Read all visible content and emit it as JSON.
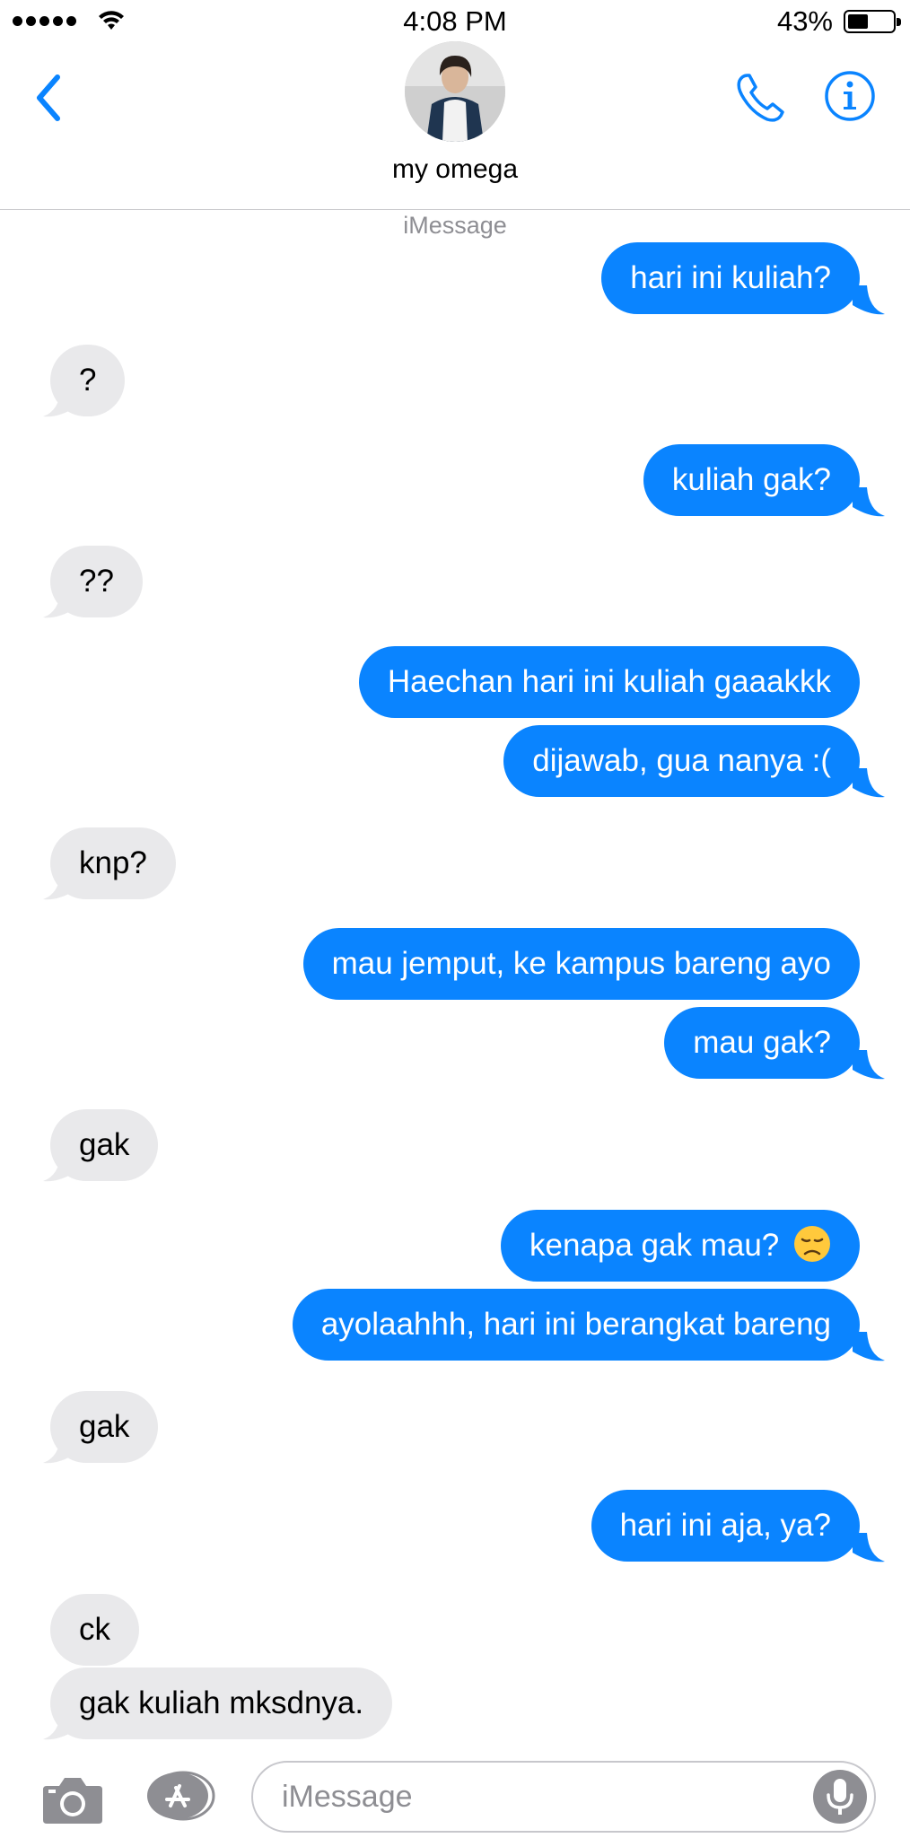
{
  "status_bar": {
    "time": "4:08 PM",
    "battery_percent": "43%",
    "battery_level": 0.43,
    "signal_bars": 5
  },
  "header": {
    "contact_name": "my omega",
    "service_label": "iMessage"
  },
  "colors": {
    "accent": "#0a84ff",
    "incoming_bubble": "#e9e9eb",
    "secondary_text": "#8e8e93"
  },
  "messages": [
    {
      "direction": "outgoing",
      "text": "hari ini kuliah?"
    },
    {
      "direction": "incoming",
      "text": "?"
    },
    {
      "direction": "outgoing",
      "text": "kuliah gak?"
    },
    {
      "direction": "incoming",
      "text": "??"
    },
    {
      "direction": "outgoing",
      "text": "Haechan hari ini kuliah gaaakkk"
    },
    {
      "direction": "outgoing",
      "text": "dijawab, gua nanya :("
    },
    {
      "direction": "incoming",
      "text": "knp?"
    },
    {
      "direction": "outgoing",
      "text": "mau jemput, ke kampus bareng ayo"
    },
    {
      "direction": "outgoing",
      "text": "mau gak?"
    },
    {
      "direction": "incoming",
      "text": "gak"
    },
    {
      "direction": "outgoing",
      "text": "kenapa gak mau?",
      "emoji": "disappointed-face"
    },
    {
      "direction": "outgoing",
      "text": "ayolaahhh, hari ini berangkat bareng"
    },
    {
      "direction": "incoming",
      "text": "gak"
    },
    {
      "direction": "outgoing",
      "text": "hari ini aja, ya?"
    },
    {
      "direction": "incoming",
      "text": "ck"
    },
    {
      "direction": "incoming",
      "text": "gak kuliah mksdnya."
    }
  ],
  "input_bar": {
    "placeholder": "iMessage"
  },
  "icons": {
    "back": "chevron-left-icon",
    "call": "phone-icon",
    "info": "info-icon",
    "camera": "camera-icon",
    "apps": "app-store-icon",
    "mic": "microphone-icon"
  }
}
